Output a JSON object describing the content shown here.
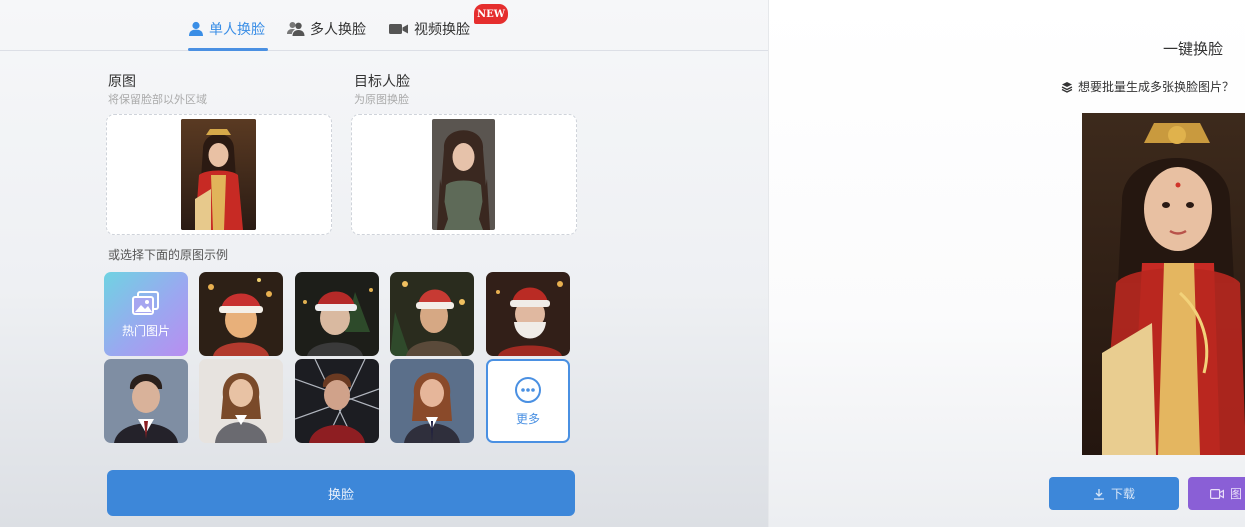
{
  "tabs": [
    {
      "label": "单人换脸",
      "icon": "user-icon",
      "active": true
    },
    {
      "label": "多人换脸",
      "icon": "users-icon",
      "active": false
    },
    {
      "label": "视频换脸",
      "icon": "video-icon",
      "active": false,
      "badge": "NEW"
    }
  ],
  "source": {
    "title": "原图",
    "subtitle": "将保留脸部以外区域"
  },
  "target": {
    "title": "目标人脸",
    "subtitle": "为原图换脸"
  },
  "examples": {
    "label": "或选择下面的原图示例",
    "hot_label": "热门图片",
    "more_label": "更多",
    "items": [
      {
        "name": "christmas-girl",
        "colors": [
          "#2d2016",
          "#c7312f",
          "#e8b07a"
        ]
      },
      {
        "name": "christmas-elder-woman",
        "colors": [
          "#1d1e19",
          "#b52a28",
          "#d9b9a0"
        ]
      },
      {
        "name": "christmas-woman",
        "colors": [
          "#2a2c1e",
          "#c73a33",
          "#d6a884"
        ]
      },
      {
        "name": "christmas-old-man",
        "colors": [
          "#321f18",
          "#ba2b24",
          "#e5d3c6"
        ]
      },
      {
        "name": "wizard-boy",
        "colors": [
          "#7f8ea3",
          "#3b2e2c",
          "#d9b29a"
        ]
      },
      {
        "name": "wizard-girl",
        "colors": [
          "#e7e3df",
          "#6a6a70",
          "#c98e6a"
        ]
      },
      {
        "name": "spider-man",
        "colors": [
          "#1c1d22",
          "#8e1e22",
          "#d7dde6"
        ]
      },
      {
        "name": "school-girl",
        "colors": [
          "#5b6f8a",
          "#2f2f3c",
          "#c28566"
        ]
      }
    ]
  },
  "swap_button": "换脸",
  "result": {
    "title": "一键换脸",
    "batch_text": "想要批量生成多张换脸图片？",
    "download_label": "下载",
    "video_label": "图"
  },
  "colors": {
    "accent": "#3d87d9",
    "badge": "#e52e2e",
    "purple": "#8a5fd6"
  }
}
